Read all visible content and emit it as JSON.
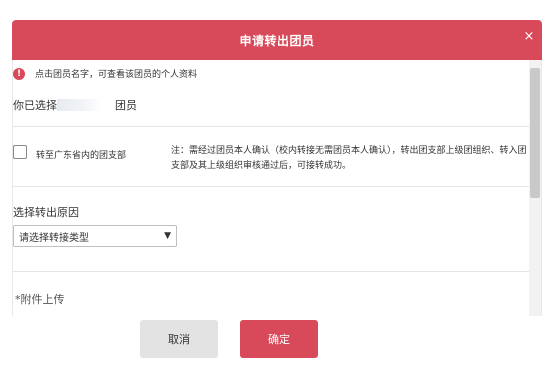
{
  "dialog": {
    "title": "申请转出团员",
    "close_glyph": "×"
  },
  "hint": {
    "icon_glyph": "!",
    "text": "点击团员名字，可查看该团员的个人资料"
  },
  "selection": {
    "prefix": "你已选择",
    "suffix": "团员"
  },
  "transfer": {
    "checkbox_label": "转至广东省内的团支部",
    "checked": false,
    "note": "注：需经过团员本人确认（校内转接无需团员本人确认），转出团支部上级团组织、转入团支部及其上级组织审核通过后，可接转成功。"
  },
  "reason": {
    "label": "选择转出原因",
    "select_value": "请选择转接类型"
  },
  "attachment": {
    "label": "*附件上传"
  },
  "footer": {
    "cancel_label": "取消",
    "ok_label": "确定"
  },
  "colors": {
    "accent": "#d84a59",
    "cancel_bg": "#e3e3e3"
  }
}
